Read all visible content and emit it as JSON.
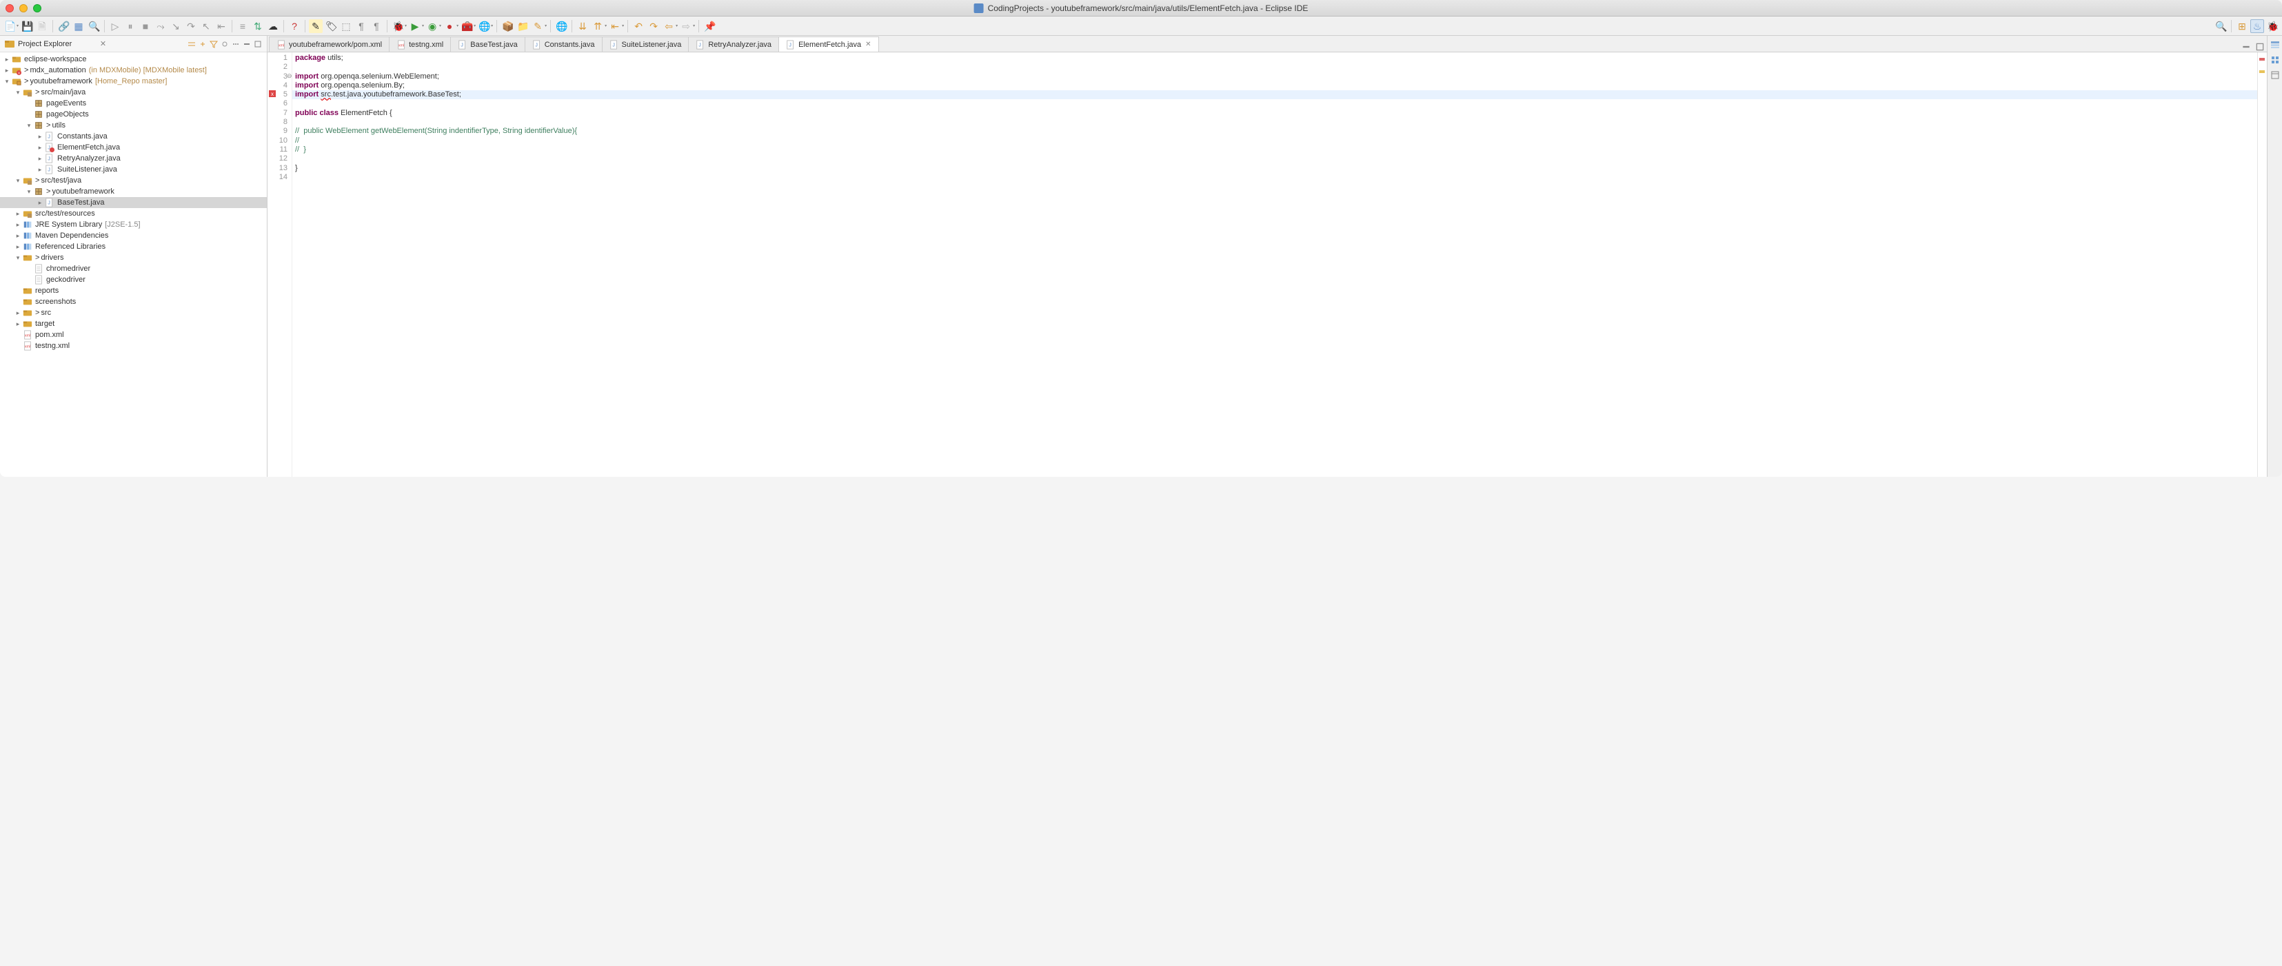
{
  "titlebar": {
    "title": "CodingProjects - youtubeframework/src/main/java/utils/ElementFetch.java - Eclipse IDE"
  },
  "explorer": {
    "title": "Project Explorer",
    "tree": [
      {
        "d": 0,
        "tw": ">",
        "ic": "ws",
        "label": "eclipse-workspace"
      },
      {
        "d": 0,
        "tw": ">",
        "ic": "proj-err",
        "pre": ">",
        "label": "mdx_automation",
        "ann": "(in MDXMobile) [MDXMobile latest]"
      },
      {
        "d": 0,
        "tw": "v",
        "ic": "proj",
        "pre": ">",
        "label": "youtubeframework",
        "ann": "[Home_Repo master]"
      },
      {
        "d": 1,
        "tw": "v",
        "ic": "srcf",
        "pre": ">",
        "label": "src/main/java"
      },
      {
        "d": 2,
        "tw": "",
        "ic": "pkg",
        "label": "pageEvents"
      },
      {
        "d": 2,
        "tw": "",
        "ic": "pkg",
        "label": "pageObjects"
      },
      {
        "d": 2,
        "tw": "v",
        "ic": "pkg",
        "pre": ">",
        "label": "utils"
      },
      {
        "d": 3,
        "tw": ">",
        "ic": "java",
        "label": "Constants.java"
      },
      {
        "d": 3,
        "tw": ">",
        "ic": "java-err",
        "label": "ElementFetch.java"
      },
      {
        "d": 3,
        "tw": ">",
        "ic": "java",
        "label": "RetryAnalyzer.java"
      },
      {
        "d": 3,
        "tw": ">",
        "ic": "java",
        "label": "SuiteListener.java"
      },
      {
        "d": 1,
        "tw": "v",
        "ic": "srcf",
        "pre": ">",
        "label": "src/test/java"
      },
      {
        "d": 2,
        "tw": "v",
        "ic": "pkg",
        "pre": ">",
        "label": "youtubeframework"
      },
      {
        "d": 3,
        "tw": ">",
        "ic": "java",
        "label": "BaseTest.java",
        "sel": true
      },
      {
        "d": 1,
        "tw": ">",
        "ic": "srcf",
        "label": "src/test/resources"
      },
      {
        "d": 1,
        "tw": ">",
        "ic": "lib",
        "label": "JRE System Library",
        "ann2": "[J2SE-1.5]"
      },
      {
        "d": 1,
        "tw": ">",
        "ic": "lib",
        "label": "Maven Dependencies"
      },
      {
        "d": 1,
        "tw": ">",
        "ic": "lib",
        "label": "Referenced Libraries"
      },
      {
        "d": 1,
        "tw": "v",
        "ic": "folder",
        "pre": ">",
        "label": "drivers"
      },
      {
        "d": 2,
        "tw": "",
        "ic": "file",
        "label": "chromedriver"
      },
      {
        "d": 2,
        "tw": "",
        "ic": "file",
        "label": "geckodriver"
      },
      {
        "d": 1,
        "tw": "",
        "ic": "folder",
        "label": "reports"
      },
      {
        "d": 1,
        "tw": "",
        "ic": "folder",
        "label": "screenshots"
      },
      {
        "d": 1,
        "tw": ">",
        "ic": "folder",
        "pre": ">",
        "label": "src"
      },
      {
        "d": 1,
        "tw": ">",
        "ic": "folder",
        "label": "target"
      },
      {
        "d": 1,
        "tw": "",
        "ic": "xml",
        "label": "pom.xml"
      },
      {
        "d": 1,
        "tw": "",
        "ic": "xml",
        "label": "testng.xml"
      }
    ]
  },
  "tabs": [
    {
      "ic": "xml",
      "label": "youtubeframework/pom.xml"
    },
    {
      "ic": "xml",
      "label": "testng.xml"
    },
    {
      "ic": "java",
      "label": "BaseTest.java"
    },
    {
      "ic": "java",
      "label": "Constants.java"
    },
    {
      "ic": "java",
      "label": "SuiteListener.java"
    },
    {
      "ic": "java",
      "label": "RetryAnalyzer.java"
    },
    {
      "ic": "java",
      "label": "ElementFetch.java",
      "active": true,
      "close": true
    }
  ],
  "code": {
    "highlight_line": 5,
    "lines": [
      {
        "n": 1,
        "html": "<span class='kw'>package</span> utils;"
      },
      {
        "n": 2,
        "html": ""
      },
      {
        "n": 3,
        "html": "<span class='kw'>import</span> org.openqa.selenium.WebElement;",
        "fold": "⊖"
      },
      {
        "n": 4,
        "html": "<span class='kw'>import</span> org.openqa.selenium.By;"
      },
      {
        "n": 5,
        "html": "<span class='kw'>import</span> <span class='err-underline'>src</span>.test.java.youtubeframework.BaseTest;",
        "err": true
      },
      {
        "n": 6,
        "html": ""
      },
      {
        "n": 7,
        "html": "<span class='kw'>public</span> <span class='kw'>class</span> ElementFetch {"
      },
      {
        "n": 8,
        "html": ""
      },
      {
        "n": 9,
        "html": "<span class='cm'>//  public WebElement getWebElement(String indentifierType, String identifierValue){</span>"
      },
      {
        "n": 10,
        "html": "<span class='cm'>//</span>"
      },
      {
        "n": 11,
        "html": "<span class='cm'>//  }</span>"
      },
      {
        "n": 12,
        "html": ""
      },
      {
        "n": 13,
        "html": "}"
      },
      {
        "n": 14,
        "html": ""
      }
    ]
  }
}
